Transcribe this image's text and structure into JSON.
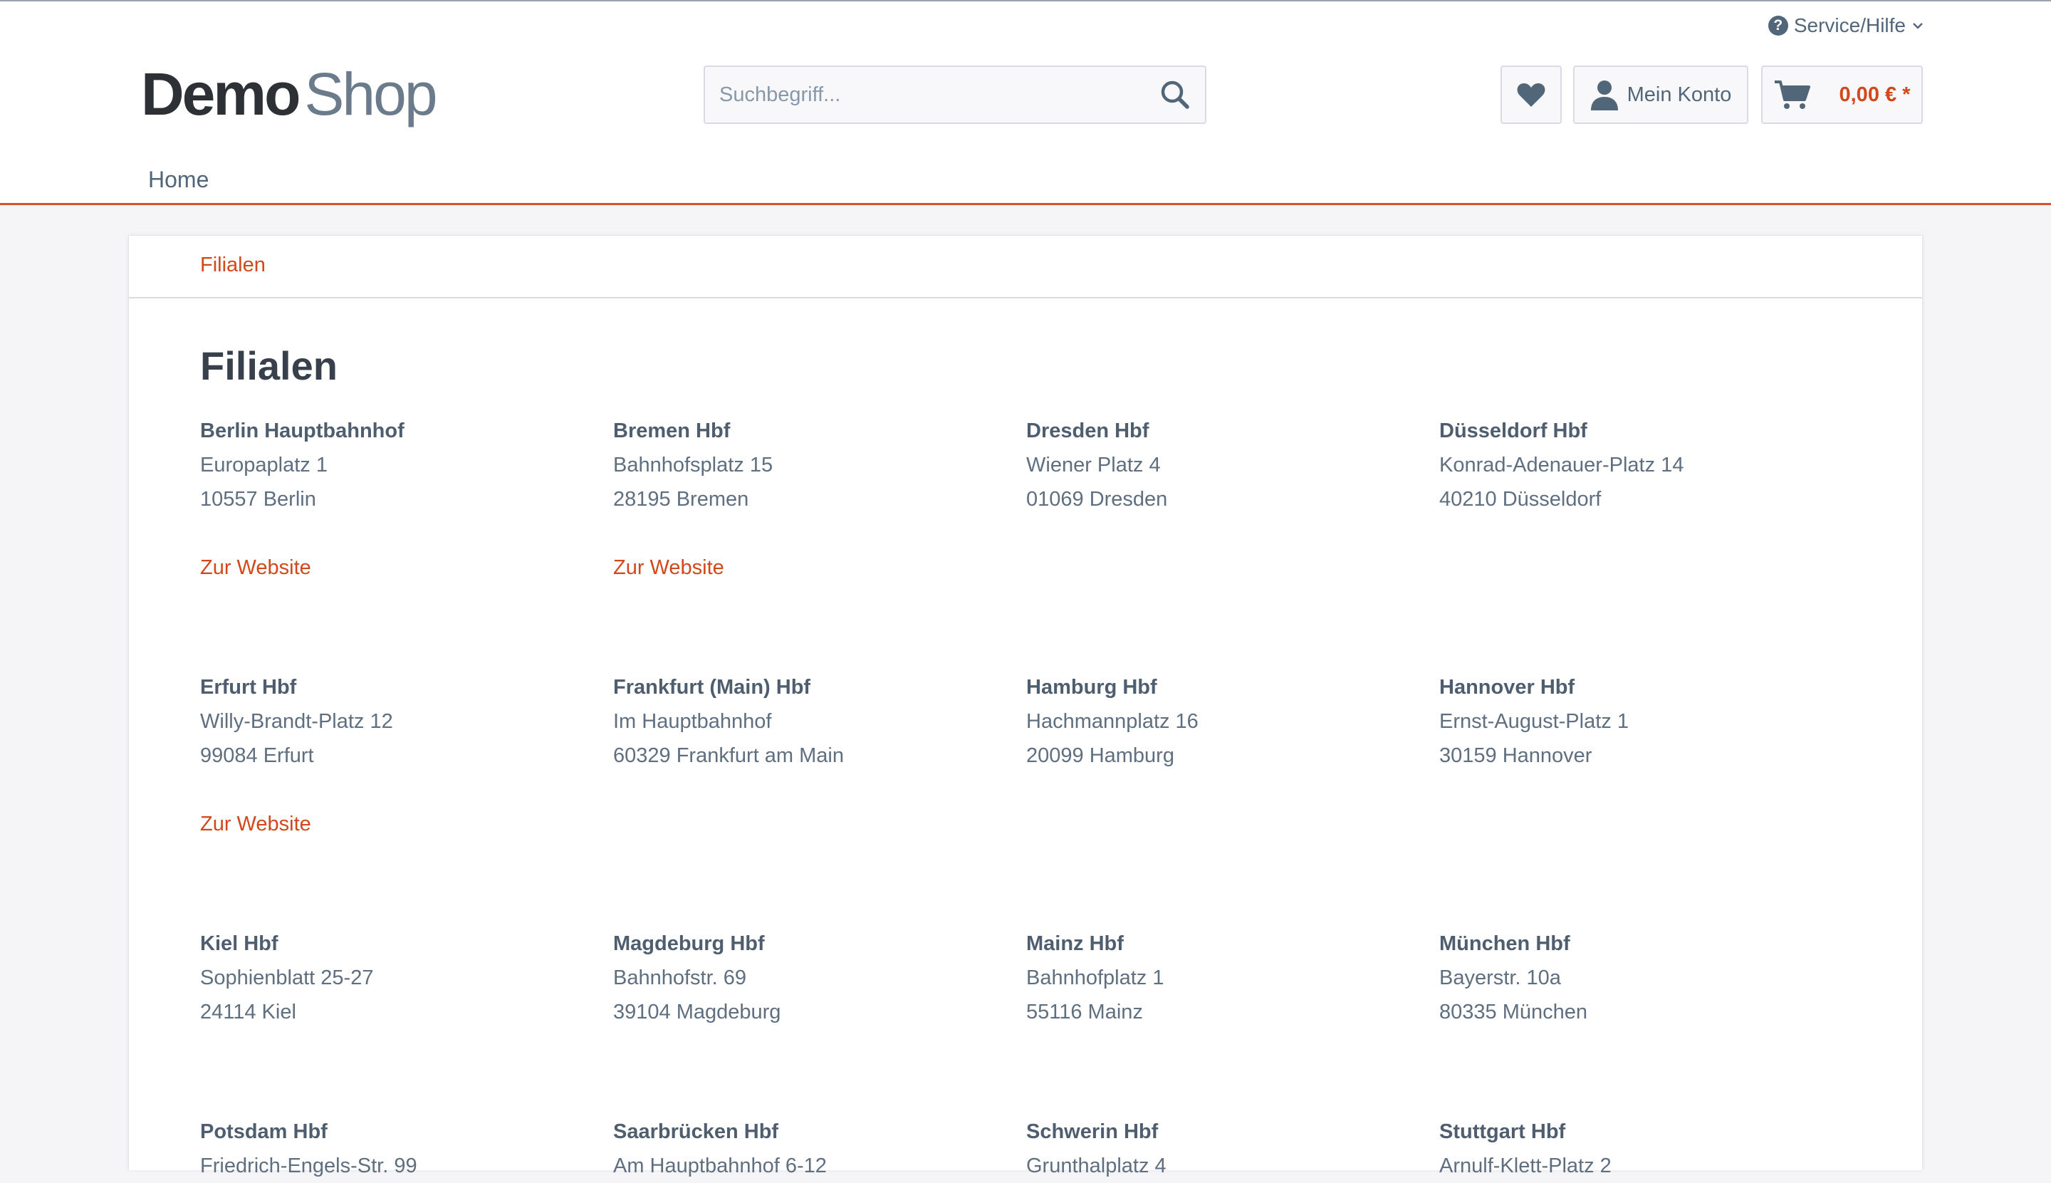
{
  "header": {
    "service_label": "Service/Hilfe",
    "logo_part1": "Demo",
    "logo_part2": "Shop",
    "search_placeholder": "Suchbegriff...",
    "account_label": "Mein Konto",
    "cart_amount": "0,00 € *"
  },
  "nav": {
    "home_label": "Home"
  },
  "breadcrumb": {
    "current": "Filialen"
  },
  "page": {
    "title": "Filialen"
  },
  "link_label": "Zur Website",
  "stores": [
    {
      "name": "Berlin Hauptbahnhof",
      "street": "Europaplatz 1",
      "city": "10557 Berlin",
      "website": "Zur Website"
    },
    {
      "name": "Bremen Hbf",
      "street": "Bahnhofsplatz 15",
      "city": "28195 Bremen",
      "website": "Zur Website"
    },
    {
      "name": "Dresden Hbf",
      "street": "Wiener Platz 4",
      "city": "01069 Dresden"
    },
    {
      "name": "Düsseldorf Hbf",
      "street": "Konrad-Adenauer-Platz 14",
      "city": "40210 Düsseldorf"
    },
    {
      "name": "Erfurt Hbf",
      "street": "Willy-Brandt-Platz 12",
      "city": "99084 Erfurt",
      "website": "Zur Website"
    },
    {
      "name": "Frankfurt (Main) Hbf",
      "street": "Im Hauptbahnhof",
      "city": "60329 Frankfurt am Main"
    },
    {
      "name": "Hamburg Hbf",
      "street": "Hachmannplatz 16",
      "city": "20099 Hamburg"
    },
    {
      "name": "Hannover Hbf",
      "street": "Ernst-August-Platz 1",
      "city": "30159 Hannover"
    },
    {
      "name": "Kiel Hbf",
      "street": "Sophienblatt 25-27",
      "city": "24114 Kiel"
    },
    {
      "name": "Magdeburg Hbf",
      "street": "Bahnhofstr. 69",
      "city": "39104 Magdeburg"
    },
    {
      "name": "Mainz Hbf",
      "street": "Bahnhofplatz 1",
      "city": "55116 Mainz"
    },
    {
      "name": "München Hbf",
      "street": "Bayerstr. 10a",
      "city": "80335 München"
    },
    {
      "name": "Potsdam Hbf",
      "street": "Friedrich-Engels-Str. 99",
      "city": ""
    },
    {
      "name": "Saarbrücken Hbf",
      "street": "Am Hauptbahnhof 6-12",
      "city": ""
    },
    {
      "name": "Schwerin Hbf",
      "street": "Grunthalplatz 4",
      "city": ""
    },
    {
      "name": "Stuttgart Hbf",
      "street": "Arnulf-Klett-Platz 2",
      "city": ""
    }
  ],
  "colors": {
    "accent": "#d1481a",
    "text": "#52667a",
    "heading": "#37404b",
    "background": "#f5f5f8"
  },
  "icons": [
    "question-circle-icon",
    "chevron-down-icon",
    "search-icon",
    "heart-icon",
    "user-icon",
    "cart-icon"
  ]
}
